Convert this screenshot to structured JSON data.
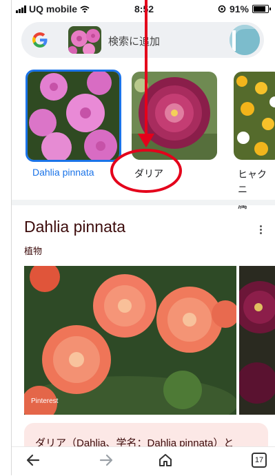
{
  "status_bar": {
    "carrier": "UQ mobile",
    "time": "8:52",
    "battery": "91%"
  },
  "search_bar": {
    "text": "検索に追加"
  },
  "carousel": [
    {
      "label": "Dahlia pinnata",
      "selected": true
    },
    {
      "label": "ダリア",
      "selected": false
    },
    {
      "label_line1": "ヒャクニ",
      "label_line2": "属",
      "selected": false
    }
  ],
  "result": {
    "title": "Dahlia pinnata",
    "subtitle": "植物",
    "image_source": "Pinterest",
    "snippet": "ダリア（Dahlia、学名：Dahlia pinnata）と"
  },
  "nav": {
    "tab_count": "17"
  },
  "colors": {
    "accent": "#1a73e8",
    "annotation_red": "#e4001b"
  }
}
